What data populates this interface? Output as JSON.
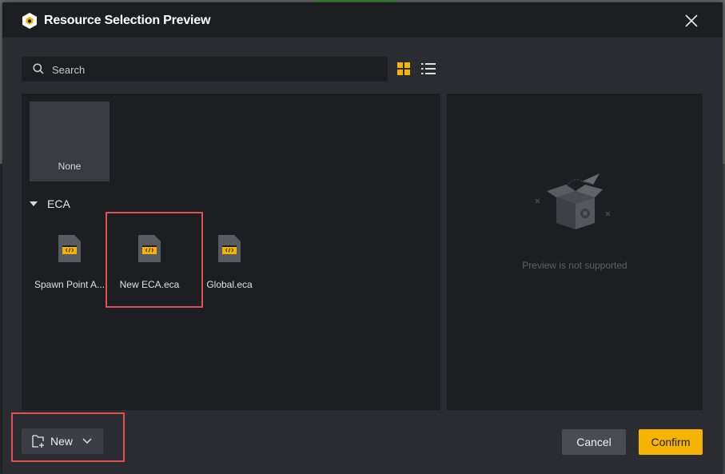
{
  "dialog": {
    "title": "Resource Selection Preview",
    "logo_icon": "app-logo-icon",
    "close_icon": "close-icon"
  },
  "search": {
    "placeholder": "Search",
    "value": "",
    "icon": "search-icon"
  },
  "view_toggle": {
    "grid_icon": "grid-view-icon",
    "list_icon": "list-view-icon",
    "active": "grid"
  },
  "resources": {
    "none_label": "None",
    "section": {
      "label": "ECA",
      "expanded": true
    },
    "items": [
      {
        "label": "Spawn Point A...",
        "icon": "eca-file-icon"
      },
      {
        "label": "New ECA.eca",
        "icon": "eca-file-icon",
        "highlighted": true
      },
      {
        "label": "Global.eca",
        "icon": "eca-file-icon"
      }
    ]
  },
  "preview": {
    "message": "Preview is not supported",
    "icon": "empty-box-icon"
  },
  "footer": {
    "new_label": "New",
    "new_icon": "new-file-icon",
    "cancel_label": "Cancel",
    "confirm_label": "Confirm"
  },
  "colors": {
    "accent": "#f5b400",
    "highlight_border": "#e05252",
    "panel_bg": "#1d1e22",
    "dialog_bg": "#2b2c31"
  }
}
